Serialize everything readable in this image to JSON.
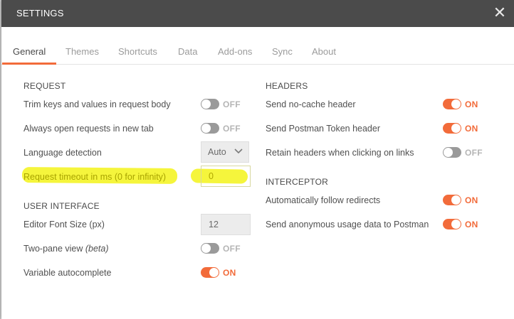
{
  "dialog": {
    "title": "SETTINGS"
  },
  "tabs": [
    {
      "label": "General",
      "active": true
    },
    {
      "label": "Themes"
    },
    {
      "label": "Shortcuts"
    },
    {
      "label": "Data"
    },
    {
      "label": "Add-ons"
    },
    {
      "label": "Sync"
    },
    {
      "label": "About"
    }
  ],
  "request": {
    "title": "REQUEST",
    "trim_keys": {
      "label": "Trim keys and values in request body",
      "state": "OFF"
    },
    "open_new_tab": {
      "label": "Always open requests in new tab",
      "state": "OFF"
    },
    "language_detection": {
      "label": "Language detection",
      "value": "Auto"
    },
    "timeout": {
      "label": "Request timeout in ms (0 for infinity)",
      "value": "0"
    }
  },
  "user_interface": {
    "title": "USER INTERFACE",
    "font_size": {
      "label": "Editor Font Size (px)",
      "value": "12"
    },
    "two_pane": {
      "label": "Two-pane view",
      "label_suffix": "(beta)",
      "state": "OFF"
    },
    "autocomplete": {
      "label": "Variable autocomplete",
      "state": "ON"
    }
  },
  "headers": {
    "title": "HEADERS",
    "no_cache": {
      "label": "Send no-cache header",
      "state": "ON"
    },
    "postman_token": {
      "label": "Send Postman Token header",
      "state": "ON"
    },
    "retain_headers": {
      "label": "Retain headers when clicking on links",
      "state": "OFF"
    }
  },
  "interceptor": {
    "title": "INTERCEPTOR",
    "follow_redirects": {
      "label": "Automatically follow redirects",
      "state": "ON"
    },
    "anonymous_usage": {
      "label": "Send anonymous usage data to Postman",
      "state": "ON"
    }
  },
  "colors": {
    "accent": "#f26b3a",
    "titlebar": "#4b4b4b",
    "highlight": "#f3f31a"
  }
}
